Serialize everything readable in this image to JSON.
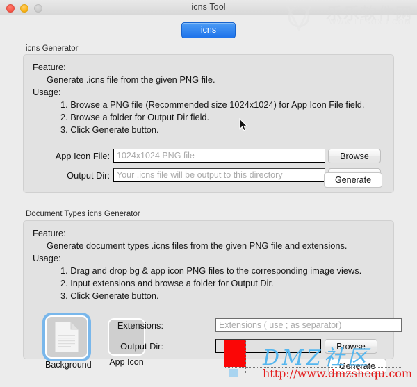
{
  "window": {
    "title": "icns Tool",
    "traffic_lights": [
      "close-button",
      "minimize-button",
      "zoom-button"
    ]
  },
  "tabbar": {
    "tabs": [
      {
        "label": "icns",
        "selected": true
      }
    ]
  },
  "section_icns": {
    "group_label": "icns Generator",
    "feature_heading": "Feature:",
    "feature_text": "Generate .icns file from the given PNG file.",
    "usage_heading": "Usage:",
    "usage_steps": [
      "1. Browse a PNG file (Recommended size 1024x1024) for App Icon File field.",
      "2. Browse a folder for Output Dir field.",
      "3. Click Generate button."
    ],
    "app_icon_file": {
      "label": "App Icon File:",
      "value": "",
      "placeholder": "1024x1024 PNG file",
      "browse_label": "Browse"
    },
    "output_dir": {
      "label": "Output Dir:",
      "value": "",
      "placeholder": "Your .icns file will be output to this directory",
      "browse_label": "Browse"
    },
    "generate_label": "Generate"
  },
  "section_doctypes": {
    "group_label": "Document Types icns Generator",
    "feature_heading": "Feature:",
    "feature_text": "Generate document types .icns files from the given PNG file and extensions.",
    "usage_heading": "Usage:",
    "usage_steps": [
      "1. Drag and drop bg & app icon PNG files to the corresponding image views.",
      "2. Input extensions and browse a folder for Output Dir.",
      "3. Click Generate button."
    ],
    "background_well": {
      "caption": "Background",
      "focused": true,
      "icon": "document-page-icon"
    },
    "appicon_well": {
      "caption": "App Icon",
      "focused": false,
      "icon": "empty-image-icon"
    },
    "extensions": {
      "label": "Extensions:",
      "value": "",
      "placeholder": "Extensions ( use ; as separator)"
    },
    "output_dir": {
      "label": "Output Dir:",
      "value": "",
      "placeholder": "",
      "browse_label": "Browse"
    },
    "generate_label": "Generate"
  },
  "watermarks": {
    "top_right_cn": "乐乐软件网",
    "top_right_url": "WWW.LESOXU.COM",
    "bottom_cn": "DMZ社区",
    "bottom_url": "http://www.dmzshequ.com"
  },
  "colors": {
    "accent_blue": "#1f73ea",
    "window_bg": "#ececec",
    "group_bg": "#e2e2e2",
    "watermark_blue": "#55b6ee",
    "watermark_red": "#e31d1d",
    "red_square": "#fb0606"
  }
}
